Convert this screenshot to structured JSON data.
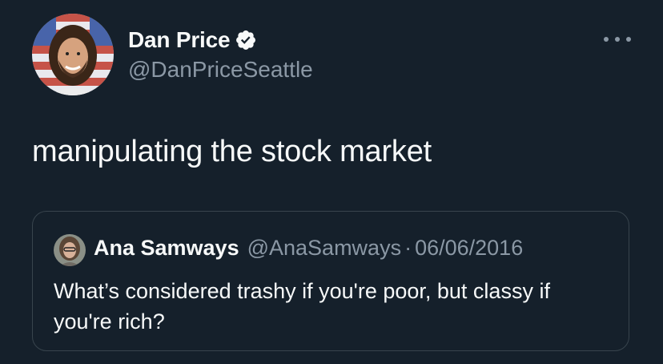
{
  "author": {
    "display_name": "Dan Price",
    "handle": "@DanPriceSeattle",
    "verified": true,
    "avatar_icon": "profile-photo-icon"
  },
  "tweet": {
    "text": "manipulating the stock market"
  },
  "menu": {
    "icon": "more-options-icon"
  },
  "quoted_tweet": {
    "display_name": "Ana Samways",
    "handle": "@AnaSamways",
    "separator": "·",
    "date": "06/06/2016",
    "text": "What’s considered trashy if you're poor, but classy if you're rich?"
  },
  "colors": {
    "background": "#15202b",
    "primary_text": "#f7f9f9",
    "secondary_text": "#8b98a5",
    "verified_badge": "#f7f9f9",
    "border": "#38444d"
  }
}
